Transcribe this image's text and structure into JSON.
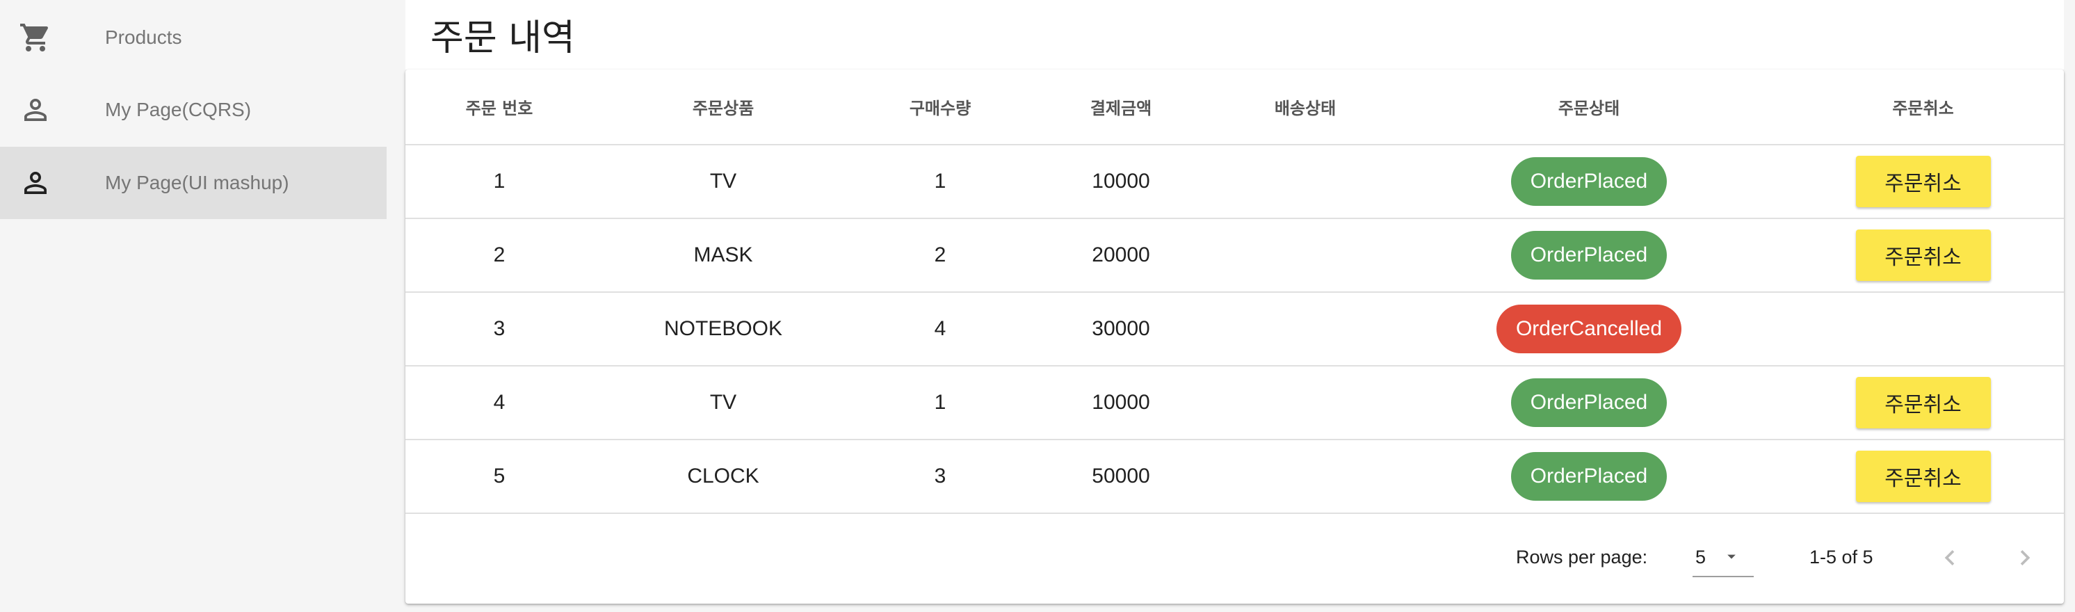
{
  "sidebar": {
    "items": [
      {
        "label": "Products",
        "icon": "cart-icon"
      },
      {
        "label": "My Page(CQRS)",
        "icon": "person-icon"
      },
      {
        "label": "My Page(UI mashup)",
        "icon": "person-icon",
        "active": true
      }
    ]
  },
  "main": {
    "title": "주문 내역"
  },
  "table": {
    "headers": [
      "주문 번호",
      "주문상품",
      "구매수량",
      "결제금액",
      "배송상태",
      "주문상태",
      "주문취소"
    ],
    "rows": [
      {
        "id": "1",
        "product": "TV",
        "qty": "1",
        "amount": "10000",
        "delivery": "",
        "status": "OrderPlaced",
        "cancel": "주문취소"
      },
      {
        "id": "2",
        "product": "MASK",
        "qty": "2",
        "amount": "20000",
        "delivery": "",
        "status": "OrderPlaced",
        "cancel": "주문취소"
      },
      {
        "id": "3",
        "product": "NOTEBOOK",
        "qty": "4",
        "amount": "30000",
        "delivery": "",
        "status": "OrderCancelled",
        "cancel": ""
      },
      {
        "id": "4",
        "product": "TV",
        "qty": "1",
        "amount": "10000",
        "delivery": "",
        "status": "OrderPlaced",
        "cancel": "주문취소"
      },
      {
        "id": "5",
        "product": "CLOCK",
        "qty": "3",
        "amount": "50000",
        "delivery": "",
        "status": "OrderPlaced",
        "cancel": "주문취소"
      }
    ]
  },
  "pagination": {
    "rows_per_page_label": "Rows per page:",
    "rows_per_page_value": "5",
    "range": "1-5 of 5"
  },
  "colors": {
    "order_placed": "#5aa45c",
    "order_cancelled": "#e04b3a",
    "cancel_button": "#fce64b",
    "sidebar_bg": "#f5f5f5",
    "sidebar_active": "#e0e0e0"
  }
}
